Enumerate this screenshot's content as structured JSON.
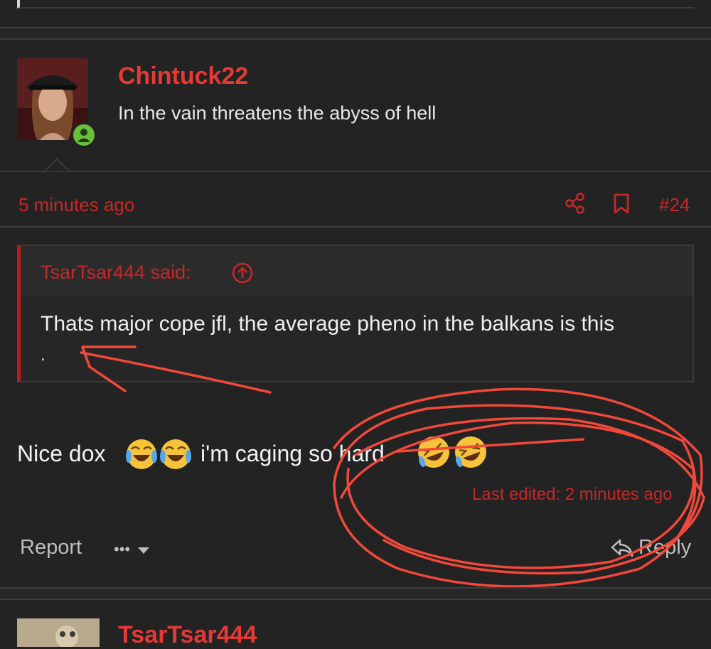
{
  "post": {
    "username": "Chintuck22",
    "user_title": "In the vain threatens the abyss of hell",
    "time": "5 minutes ago",
    "post_number": "#24",
    "quote": {
      "author": "TsarTsar444 said:",
      "text": "Thats major cope jfl, the average pheno in the balkans is this",
      "extra": "."
    },
    "body_start": "Nice dox",
    "body_mid": "i'm caging so hard",
    "last_edited": "Last edited: 2 minutes ago",
    "report_label": "Report",
    "more_label": "•••",
    "reply_label": "Reply"
  },
  "next_post": {
    "username": "TsarTsar444"
  },
  "colors": {
    "accent": "#e53935",
    "online": "#6bbf3a",
    "background": "#232323"
  }
}
